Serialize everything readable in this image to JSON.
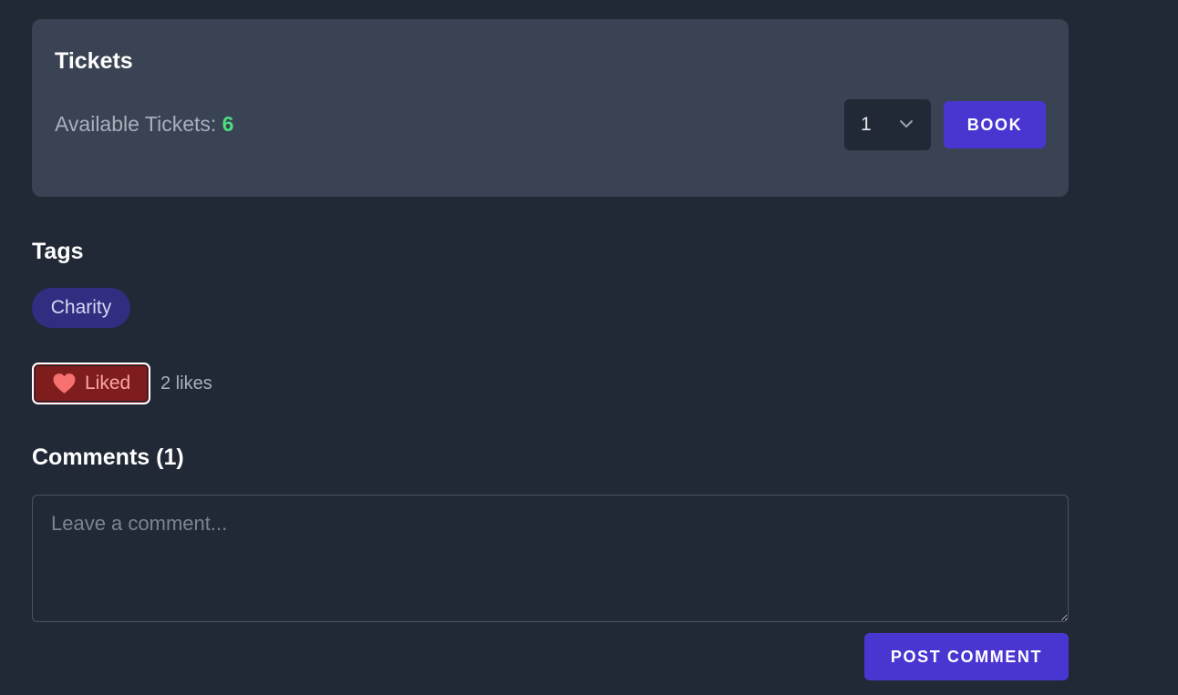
{
  "tickets": {
    "title": "Tickets",
    "available_label": "Available Tickets:",
    "available_count": "6",
    "quantity_selected": "1",
    "book_label": "BOOK",
    "count_color": "#4ade80"
  },
  "tags": {
    "title": "Tags",
    "items": [
      {
        "label": "Charity"
      }
    ]
  },
  "likes": {
    "button_label": "Liked",
    "count_text": "2 likes",
    "icon": "heart-icon",
    "heart_color": "#f87171"
  },
  "comments": {
    "title": "Comments (1)",
    "placeholder": "Leave a comment...",
    "value": "",
    "post_label": "POST COMMENT"
  },
  "colors": {
    "background": "#212836",
    "card": "#3a4353",
    "primary_button": "#4936d1",
    "tag_bg": "#312e81",
    "liked_bg": "#7f1d1d"
  }
}
